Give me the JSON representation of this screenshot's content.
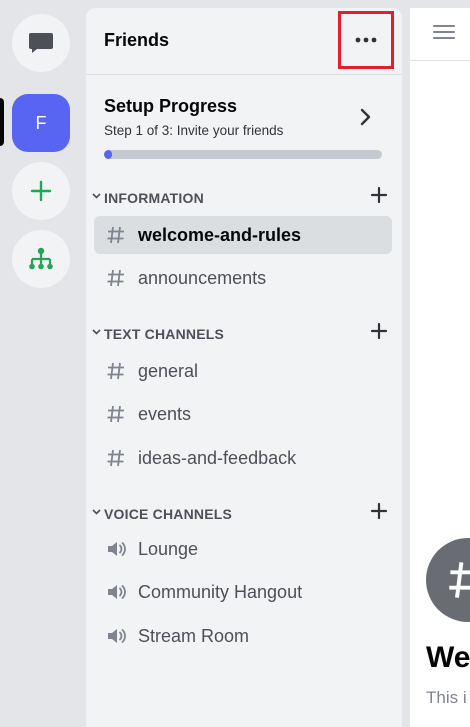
{
  "servers": {
    "active_initial": "F"
  },
  "server_header": {
    "name": "Friends"
  },
  "setup": {
    "title": "Setup Progress",
    "subtitle": "Step 1 of 3: Invite your friends",
    "progress": 0.03
  },
  "categories": [
    {
      "label": "INFORMATION",
      "channels": [
        {
          "name": "welcome-and-rules",
          "type": "text",
          "selected": true
        },
        {
          "name": "announcements",
          "type": "text"
        }
      ]
    },
    {
      "label": "TEXT CHANNELS",
      "channels": [
        {
          "name": "general",
          "type": "text"
        },
        {
          "name": "events",
          "type": "text"
        },
        {
          "name": "ideas-and-feedback",
          "type": "text"
        }
      ]
    },
    {
      "label": "VOICE CHANNELS",
      "channels": [
        {
          "name": "Lounge",
          "type": "voice"
        },
        {
          "name": "Community Hangout",
          "type": "voice"
        },
        {
          "name": "Stream Room",
          "type": "voice"
        }
      ]
    }
  ],
  "main": {
    "welcome_title": "Wel",
    "welcome_sub": "This i"
  },
  "colors": {
    "accent": "#5865f2",
    "highlight_box": "#e0202e"
  }
}
